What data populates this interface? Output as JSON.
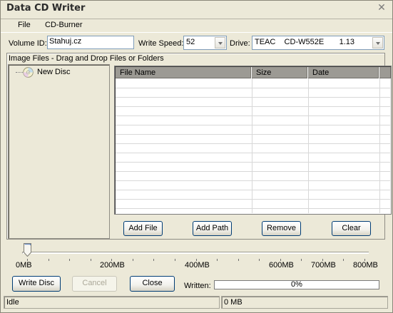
{
  "window": {
    "title": "Data CD Writer"
  },
  "menu": [
    "File",
    "CD-Burner"
  ],
  "options": {
    "volume_id_label": "Volume ID:",
    "volume_id_value": "Stahuj.cz",
    "write_speed_label": "Write Speed:",
    "write_speed_value": "52",
    "drive_label": "Drive:",
    "drive_value": "TEAC    CD-W552E       1.13"
  },
  "files_group": {
    "label": "Image Files - Drag and  Drop Files or Folders",
    "tree_root": "New Disc",
    "columns": [
      "File Name",
      "Size",
      "Date"
    ],
    "rows": []
  },
  "file_buttons": {
    "add_file": "Add File",
    "add_path": "Add Path",
    "remove": "Remove",
    "clear": "Clear"
  },
  "capacity_scale": {
    "ticks": [
      "0MB",
      "200MB",
      "400MB",
      "600MB",
      "700MB",
      "800MB"
    ],
    "selected_mb": 0
  },
  "actions": {
    "write": "Write Disc",
    "cancel": "Cancel",
    "close": "Close"
  },
  "progress": {
    "label": "Written:",
    "value_text": "0%",
    "fraction": 0
  },
  "status": {
    "state": "Idle",
    "size": "0 MB"
  },
  "colors": {
    "background": "#ece9d8",
    "progress_fill": "#3169c6",
    "grid_header": "#9c9a94"
  }
}
